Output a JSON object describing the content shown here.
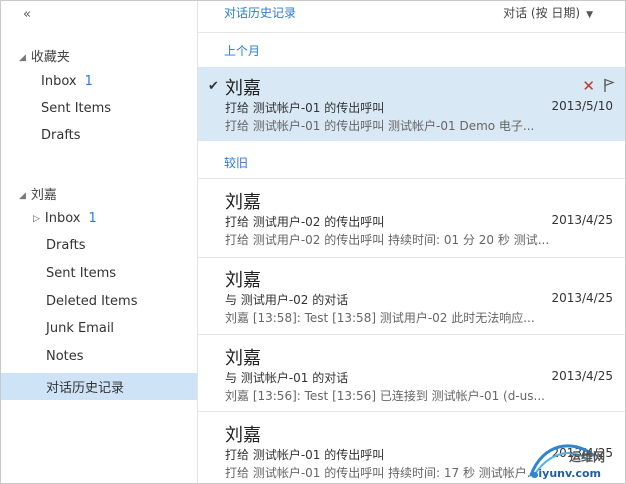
{
  "nav": {
    "collapse_glyph": "«",
    "favorites": {
      "label": "收藏夹",
      "items": [
        {
          "label": "Inbox",
          "count": "1"
        },
        {
          "label": "Sent Items"
        },
        {
          "label": "Drafts"
        }
      ]
    },
    "account": {
      "label": "刘嘉",
      "items": [
        {
          "label": "Inbox",
          "count": "1"
        },
        {
          "label": "Drafts"
        },
        {
          "label": "Sent Items"
        },
        {
          "label": "Deleted Items"
        },
        {
          "label": "Junk Email"
        },
        {
          "label": "Notes"
        },
        {
          "label": "对话历史记录"
        }
      ]
    }
  },
  "pane": {
    "title": "对话历史记录",
    "sort_label": "对话 (按 日期)",
    "groups": {
      "last_month": "上个月",
      "older": "较旧"
    },
    "messages": [
      {
        "name": "刘嘉",
        "subject": "打给 测试帐户-01 的传出呼叫",
        "date": "2013/5/10",
        "preview": "打给 测试帐户-01 的传出呼叫 测试帐户-01 Demo 电子..."
      },
      {
        "name": "刘嘉",
        "subject": "打给 测试用户-02 的传出呼叫",
        "date": "2013/4/25",
        "preview": "打给 测试用户-02 的传出呼叫 持续时间: 01 分 20 秒 测试..."
      },
      {
        "name": "刘嘉",
        "subject": "与 测试用户-02 的对话",
        "date": "2013/4/25",
        "preview": "刘嘉 [13:58]: Test [13:58] 测试用户-02 此时无法响应..."
      },
      {
        "name": "刘嘉",
        "subject": "与 测试帐户-01 的对话",
        "date": "2013/4/25",
        "preview": "刘嘉 [13:56]: Test [13:56] 已连接到 测试帐户-01 (d-us..."
      },
      {
        "name": "刘嘉",
        "subject": "打给 测试帐户-01 的传出呼叫",
        "date": "2013/4/25",
        "preview": "打给 测试帐户-01 的传出呼叫 持续时间: 17 秒 测试帐户..."
      }
    ]
  },
  "watermark": {
    "text": "运维网",
    "url": "iyunv.com"
  },
  "colors": {
    "accent": "#2b7bcf",
    "selected_bg": "#cfe3f6",
    "active_msg_bg": "#d9e8f5",
    "delete_red": "#c0392b"
  }
}
